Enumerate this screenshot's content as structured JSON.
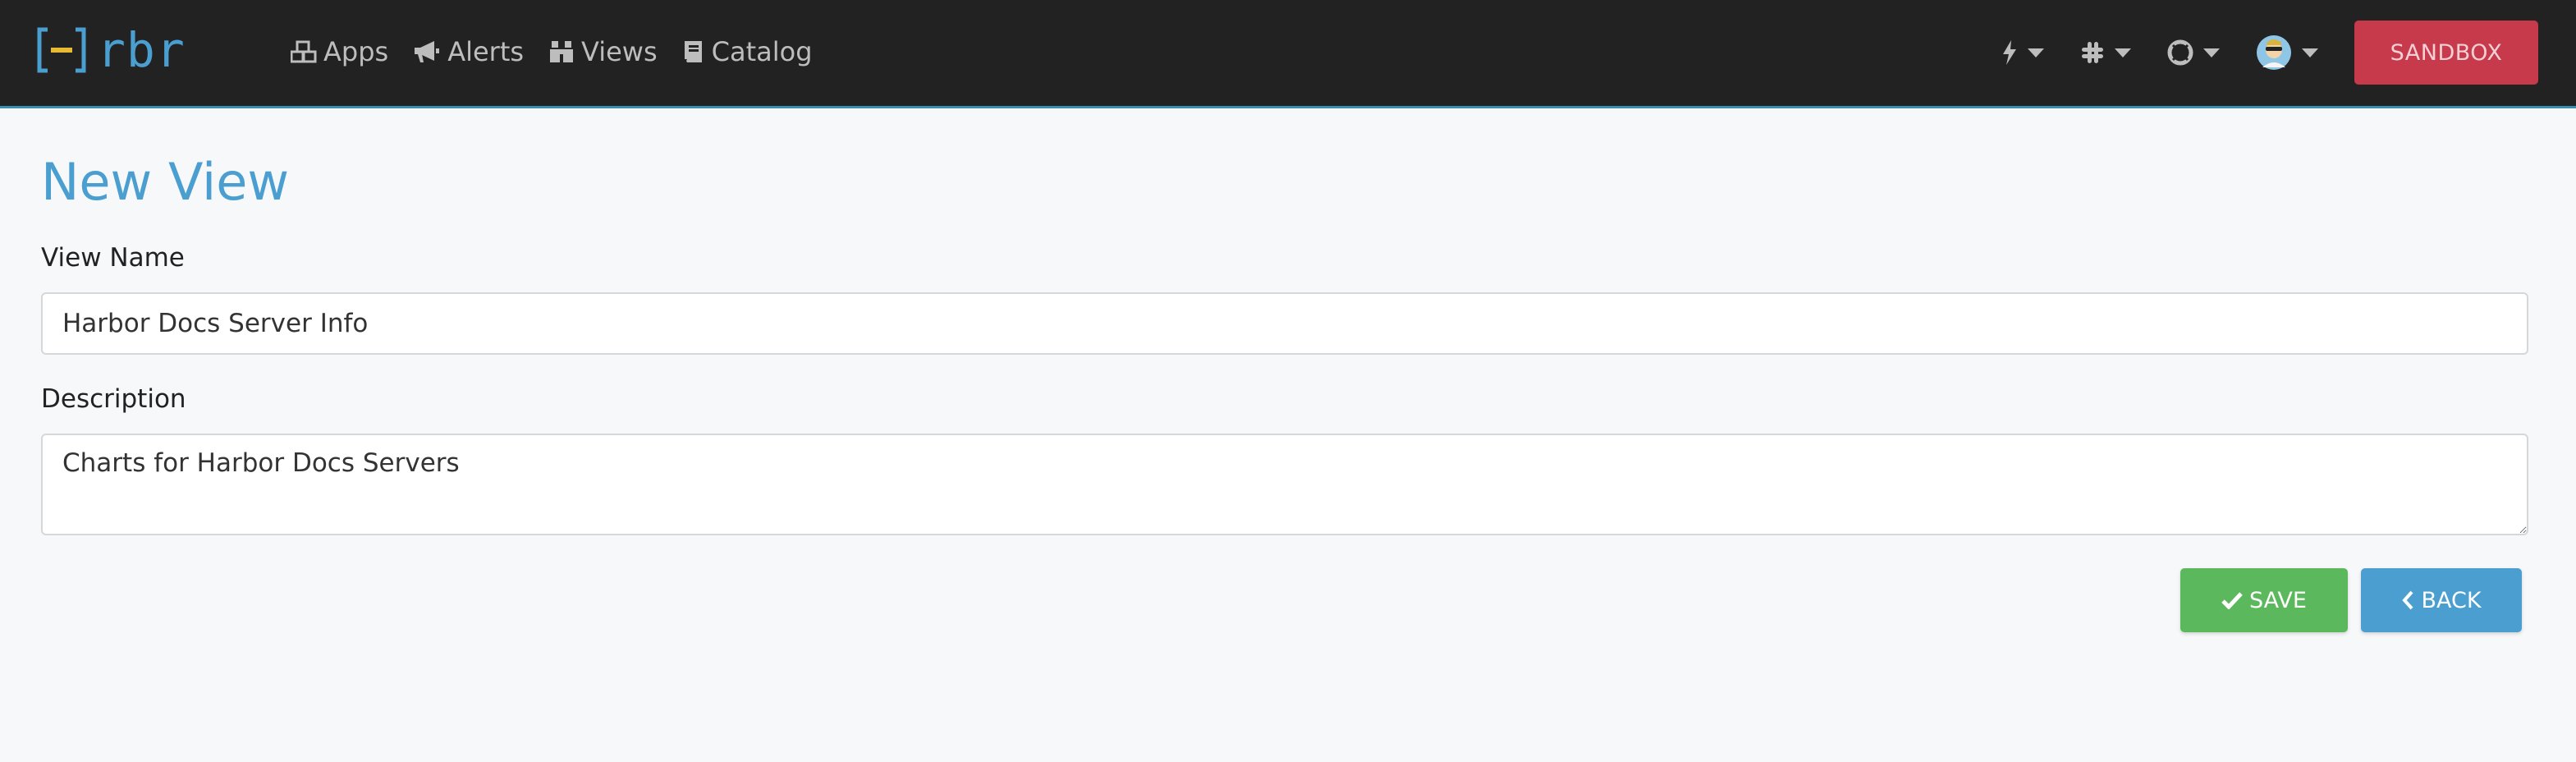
{
  "app": {
    "logo_text": "rbr"
  },
  "nav": {
    "items": [
      {
        "label": "Apps",
        "icon": "cubes-icon"
      },
      {
        "label": "Alerts",
        "icon": "bullhorn-icon"
      },
      {
        "label": "Views",
        "icon": "binoculars-icon"
      },
      {
        "label": "Catalog",
        "icon": "book-icon"
      }
    ],
    "right_menus": [
      "bolt-icon",
      "slack-icon",
      "life-ring-icon",
      "user-avatar"
    ],
    "sandbox_label": "SANDBOX"
  },
  "page": {
    "title": "New View"
  },
  "form": {
    "view_name_label": "View Name",
    "view_name_value": "Harbor Docs Server Info",
    "description_label": "Description",
    "description_value": "Charts for Harbor Docs Servers",
    "save_label": "SAVE",
    "back_label": "BACK"
  },
  "colors": {
    "navbar": "#222222",
    "accent": "#4a9fd0",
    "save": "#5cb85c",
    "sandbox": "#c63a4b"
  }
}
